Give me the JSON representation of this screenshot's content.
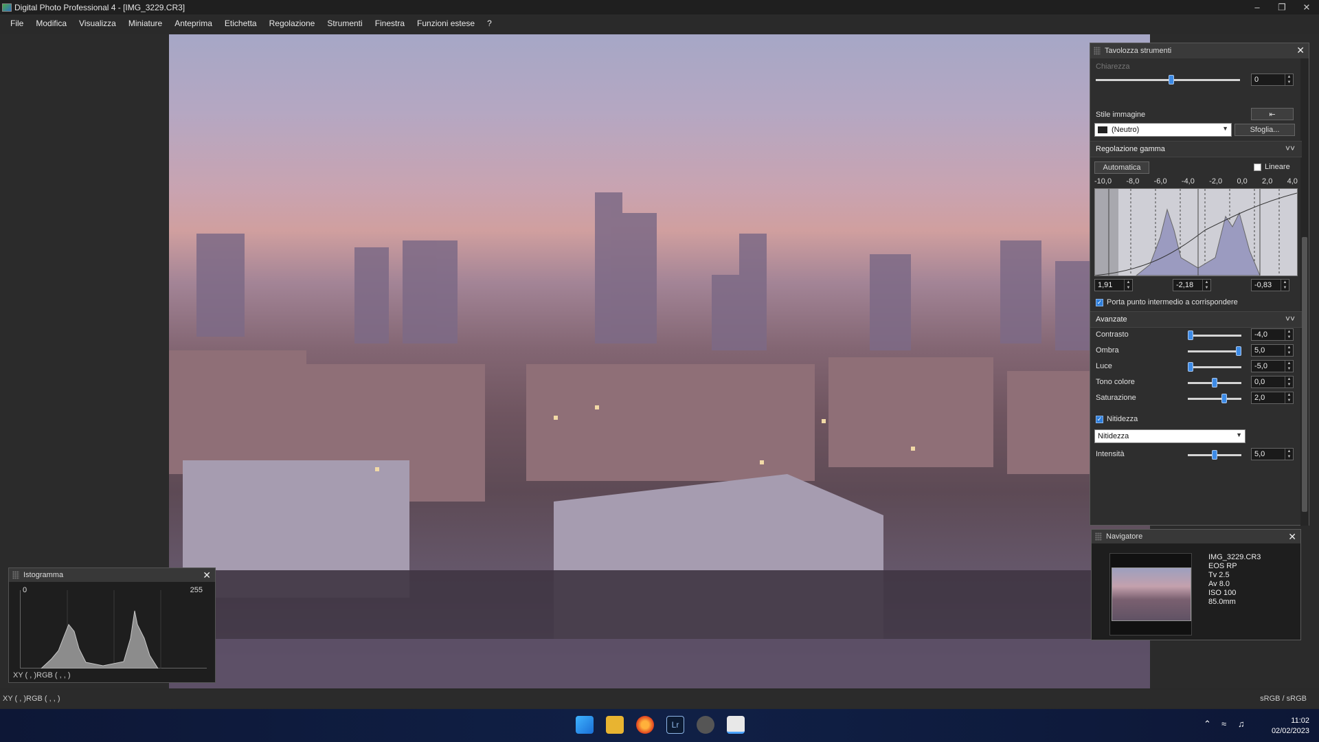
{
  "window": {
    "title": "Digital Photo Professional 4 - [IMG_3229.CR3]",
    "min_icon": "minimize-icon",
    "restore_icon": "restore-icon",
    "close_icon": "close-icon"
  },
  "menu": [
    "File",
    "Modifica",
    "Visualizza",
    "Miniature",
    "Anteprima",
    "Etichetta",
    "Regolazione",
    "Strumenti",
    "Finestra",
    "Funzioni estese",
    "?"
  ],
  "histogram": {
    "title": "Istogramma",
    "min_label": "0",
    "max_label": "255",
    "readout": "XY (    ,    )RGB (   ,   ,   )"
  },
  "tools": {
    "title": "Tavolozza strumenti",
    "clarity": {
      "label": "Chiarezza",
      "value": "0"
    },
    "picture_style": {
      "label": "Stile immagine",
      "selected": "(Neutro)",
      "browse_label": "Sfoglia..."
    },
    "gamma": {
      "section_label": "Regolazione gamma",
      "auto_label": "Automatica",
      "linear_label": "Lineare",
      "ticks": [
        "-10,0",
        "-8,0",
        "-6,0",
        "-4,0",
        "-2,0",
        "0,0",
        "2,0",
        "4,0"
      ],
      "left_value": "1,91",
      "mid_value": "-2,18",
      "right_value": "-0,83",
      "link_midpoint_label": "Porta punto intermedio a corrispondere"
    },
    "advanced": {
      "section_label": "Avanzate",
      "sliders": [
        {
          "label": "Contrasto",
          "value": "-4,0",
          "fraction": 0.0
        },
        {
          "label": "Ombra",
          "value": "5,0",
          "fraction": 1.0
        },
        {
          "label": "Luce",
          "value": "-5,0",
          "fraction": 0.0
        },
        {
          "label": "Tono colore",
          "value": "0,0",
          "fraction": 0.5
        },
        {
          "label": "Saturazione",
          "value": "2,0",
          "fraction": 0.7
        }
      ]
    },
    "sharpness": {
      "checkbox_label": "Nitidezza",
      "mode_selected": "Nitidezza",
      "intensity_label": "Intensità",
      "intensity_value": "5,0",
      "intensity_fraction": 0.5
    }
  },
  "navigator": {
    "title": "Navigatore",
    "filename": "IMG_3229.CR3",
    "camera": "EOS RP",
    "tv": "Tv 2.5",
    "av": "Av 8.0",
    "iso": "ISO 100",
    "focal": "85.0mm"
  },
  "statusbar": {
    "readout": "XY (    ,    )RGB (   ,   ,   )",
    "colorspace": "sRGB / sRGB"
  },
  "taskbar": {
    "time": "11:02",
    "date": "02/02/2023"
  }
}
